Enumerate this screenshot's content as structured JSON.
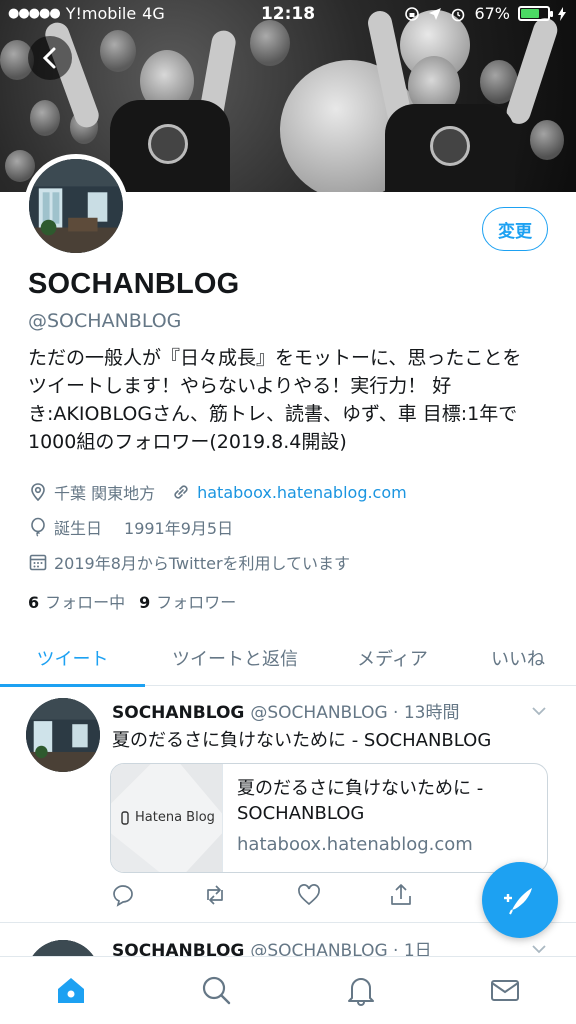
{
  "status_bar": {
    "carrier": "Y!mobile",
    "network": "4G",
    "time": "12:18",
    "battery_percent": "67%",
    "battery_level": 0.67
  },
  "profile": {
    "change_button": "変更",
    "display_name": "SOCHANBLOG",
    "handle": "@SOCHANBLOG",
    "bio": "ただの一般人が『日々成長』をモットーに、思ったことを\nツイートします！やらないよりやる！実行力！ 好\nき:AKIOBLOGさん、筋トレ、読書、ゆず、車 目標:1年で\n1000組のフォロワー(2019.8.4開設)",
    "location": "千葉 関東地方",
    "website": "hataboox.hatenablog.com",
    "birthday_label": "誕生日",
    "birthday": "1991年9月5日",
    "joined": "2019年8月からTwitterを利用しています",
    "following_count": "6",
    "following_label": "フォロー中",
    "followers_count": "9",
    "followers_label": "フォロワー"
  },
  "tabs": [
    {
      "label": "ツイート",
      "active": true
    },
    {
      "label": "ツイートと返信",
      "active": false
    },
    {
      "label": "メディア",
      "active": false
    },
    {
      "label": "いいね",
      "active": false
    }
  ],
  "tweets": [
    {
      "name": "SOCHANBLOG",
      "meta": "@SOCHANBLOG · 13時間",
      "text": "夏のだるさに負けないために - SOCHANBLOG",
      "card": {
        "brand": "Hatena Blog",
        "title": "夏のだるさに負けないために -\nSOCHANBLOG",
        "url": "hataboox.hatenablog.com"
      }
    },
    {
      "name": "SOCHANBLOG",
      "meta": "@SOCHANBLOG · 1日"
    }
  ],
  "icons": {
    "back": "chevron-left-icon",
    "location": "location-pin-icon",
    "link": "link-icon",
    "birthday": "balloon-icon",
    "calendar": "calendar-icon",
    "reply": "reply-icon",
    "retweet": "retweet-icon",
    "like": "heart-icon",
    "share": "share-icon",
    "compose": "compose-tweet-icon",
    "home": "home-icon",
    "search": "search-icon",
    "notifications": "bell-icon",
    "messages": "mail-icon"
  },
  "colors": {
    "accent": "#1da1f2",
    "secondary_text": "#657786",
    "border": "#e1e8ed"
  }
}
